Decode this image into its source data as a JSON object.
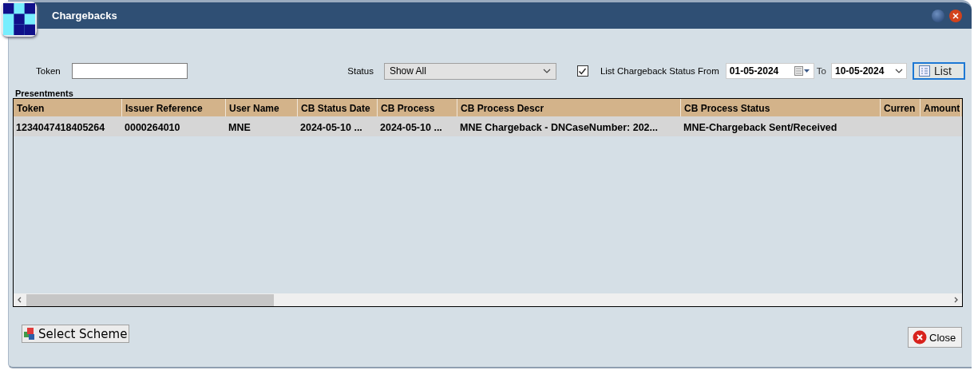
{
  "window": {
    "title": "Chargebacks"
  },
  "filters": {
    "token": {
      "label": "Token"
    },
    "status": {
      "label": "Status",
      "value": "Show All"
    },
    "list_status": {
      "label": "List Chargeback Status From",
      "checked": true
    },
    "from_date": "01-05-2024",
    "to_label": "To",
    "to_date": "10-05-2024",
    "list_button": "List"
  },
  "presentments": {
    "title": "Presentments",
    "columns": [
      "Token",
      "Issuer Reference",
      "User Name",
      "CB Status Date",
      "CB Process",
      "CB Process Descr",
      "CB Process Status",
      "Curren",
      "Amount"
    ],
    "rows": [
      {
        "cells": [
          "1234047418405264",
          "0000264010",
          "MNE",
          "2024-05-10 ...",
          "2024-05-10 ...",
          "MNE Chargeback - DNCaseNumber: 202...",
          "MNE-Chargeback Sent/Received",
          "",
          ""
        ],
        "selected": true
      }
    ]
  },
  "buttons": {
    "select_scheme": "Select Scheme",
    "close": "Close"
  }
}
